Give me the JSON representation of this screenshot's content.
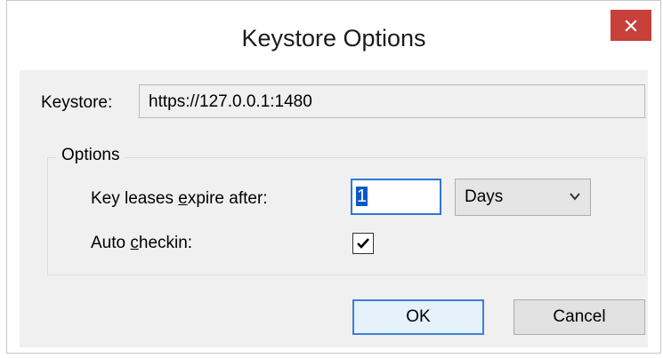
{
  "window": {
    "title": "Keystore Options",
    "close_glyph": "✕"
  },
  "keystore": {
    "label": "Keystore:",
    "value": "https://127.0.0.1:1480"
  },
  "options": {
    "group_label": "Options",
    "expire": {
      "label_before": "Key leases ",
      "label_accel": "e",
      "label_after": "xpire after:",
      "value": "1",
      "unit": "Days"
    },
    "auto_checkin": {
      "label_before": "Auto ",
      "label_accel": "c",
      "label_after": "heckin:",
      "checked": true,
      "check_glyph": "✔"
    }
  },
  "buttons": {
    "ok": "OK",
    "cancel": "Cancel"
  },
  "colors": {
    "close_button": "#c7403a",
    "focus_border": "#2b78d6"
  }
}
